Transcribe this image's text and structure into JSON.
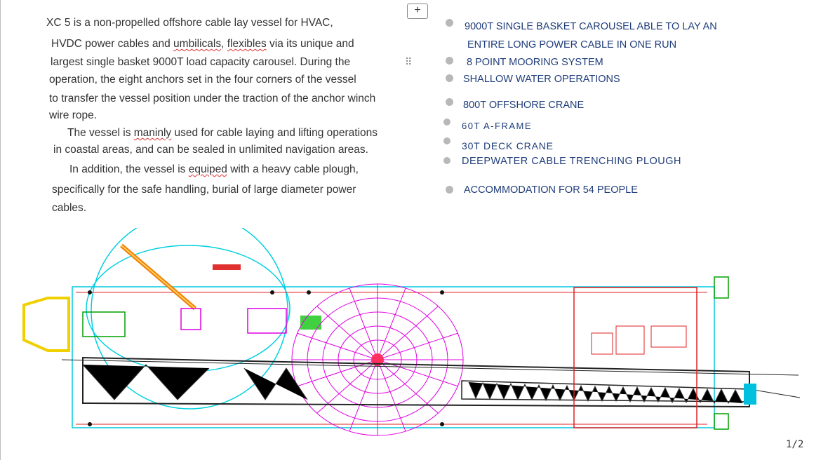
{
  "paragraph": {
    "line1": "XC 5  is a  non-propelled offshore cable lay vessel for  HVAC,",
    "line2a": "HVDC power cables and ",
    "line2w1": "umbilicals",
    "line2b": ", ",
    "line2w2": "flexibles",
    "line2c": " via its unique and",
    "line3": "largest single  basket 9000T load capacity carousel.  During the",
    "line4": "operation, the eight anchors set in the four corners of the vessel",
    "line5": "to transfer the vessel position under the traction of the anchor winch",
    "line6": "wire rope.",
    "line7a": "The vessel is ",
    "line7w": "maninly",
    "line7b": " used for cable laying and lifting operations",
    "line8": "in coastal areas,  and can be sealed in unlimited navigation areas.",
    "line9a": "In addition, the vessel is ",
    "line9w": "equiped",
    "line9b": " with a heavy cable plough,",
    "line10": "specifically for the safe handling, burial    of  large diameter power",
    "line11": "cables."
  },
  "features": {
    "item1a": "9000T SINGLE BASKET CAROUSEL ABLE TO LAY AN",
    "item1b": "ENTIRE LONG POWER CABLE IN ONE RUN",
    "item2": "8 POINT MOORING SYSTEM",
    "item3": "SHALLOW WATER OPERATIONS",
    "item4": "800T OFFSHORE CRANE",
    "item5": "60T  A-FRAME",
    "item6": "30T  DECK CRANE",
    "item7": "DEEPWATER CABLE TRENCHING PLOUGH",
    "item8": "ACCOMMODATION FOR 54 PEOPLE"
  },
  "controls": {
    "plus": "+",
    "drag": "⠿"
  },
  "page": {
    "number": "1/2"
  },
  "icons": {
    "add": "plus-icon",
    "drag": "drag-handle-icon"
  },
  "colors": {
    "feature_text": "#1f3d7a",
    "carousel": "#e000e0",
    "hull": "#e00000",
    "deck": "#00c8e0"
  }
}
